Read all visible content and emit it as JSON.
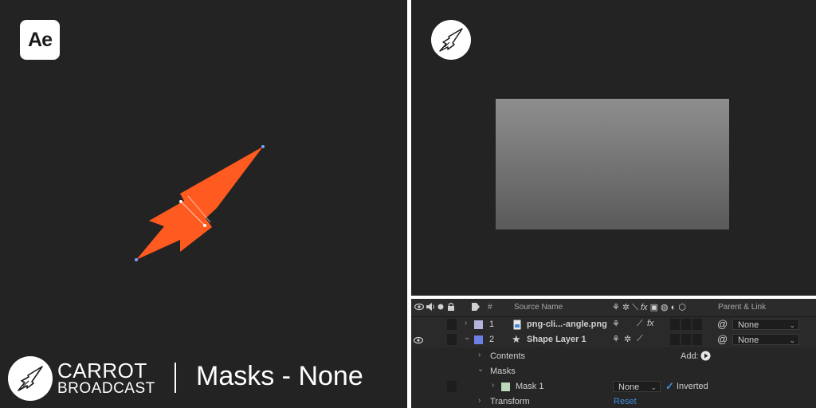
{
  "app_logo": {
    "text": "Ae"
  },
  "brand": {
    "line1": "CARROT",
    "line2": "BROADCAST",
    "title": "Masks - None"
  },
  "colors": {
    "shape_fill": "#ff5a1f",
    "accent_blue": "#3e8ddb",
    "layer1_swatch": "#b3b3dd",
    "layer2_swatch": "#6b7fe6",
    "mask_swatch": "#b9d9b9"
  },
  "timeline": {
    "header": {
      "hash": "#",
      "source_name": "Source Name",
      "parent_link": "Parent & Link"
    },
    "layers": [
      {
        "index": "1",
        "name": "png-cli...-angle.png",
        "parent": "None",
        "icon": "image-file-icon"
      },
      {
        "index": "2",
        "name": "Shape Layer 1",
        "parent": "None",
        "icon": "star-icon"
      }
    ],
    "contents_label": "Contents",
    "add_label": "Add:",
    "masks_label": "Masks",
    "mask": {
      "name": "Mask 1",
      "mode": "None",
      "inverted_label": "Inverted",
      "inverted": true
    },
    "transform_label": "Transform",
    "reset_label": "Reset"
  }
}
